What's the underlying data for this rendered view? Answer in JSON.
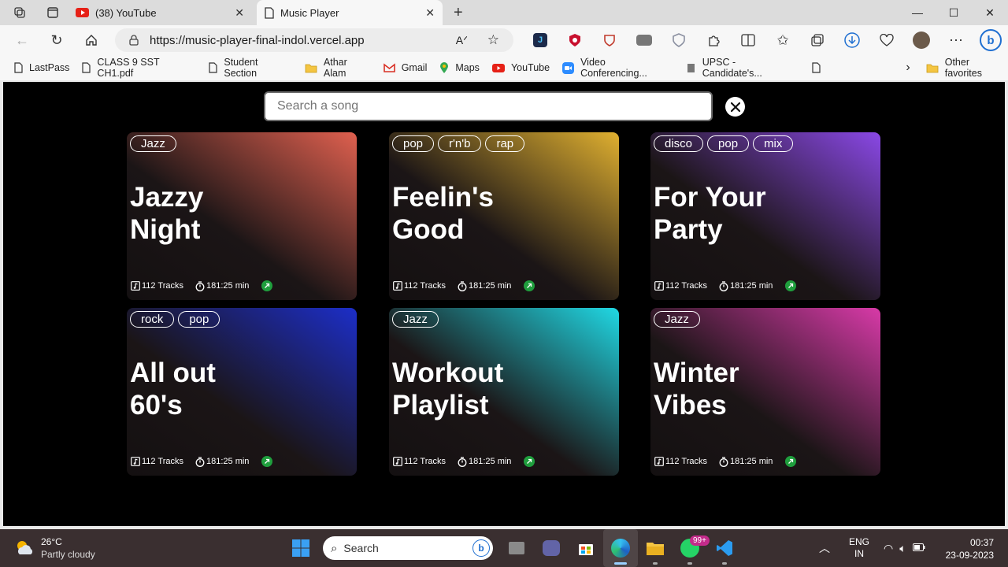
{
  "browser": {
    "tabs": [
      {
        "title": "(38) YouTube",
        "active": false
      },
      {
        "title": "Music Player",
        "active": true
      }
    ],
    "url": "https://music-player-final-indol.vercel.app",
    "bookmarks": [
      "LastPass",
      "CLASS 9 SST CH1.pdf",
      "Student Section",
      "Athar Alam",
      "Gmail",
      "Maps",
      "YouTube",
      "Video Conferencing...",
      "UPSC - Candidate's..."
    ],
    "other_favorites": "Other favorites"
  },
  "app": {
    "search_placeholder": "Search a song",
    "playlists": [
      {
        "title_line1": "Jazzy",
        "title_line2": "Night",
        "tags": [
          "Jazz"
        ],
        "tracks": "112 Tracks",
        "duration": "181:25 min",
        "color": "#e0604f"
      },
      {
        "title_line1": "Feelin's",
        "title_line2": "Good",
        "tags": [
          "pop",
          "r'n'b",
          "rap"
        ],
        "tracks": "112 Tracks",
        "duration": "181:25 min",
        "color": "#e0b030"
      },
      {
        "title_line1": "For Your",
        "title_line2": "Party",
        "tags": [
          "disco",
          "pop",
          "mix"
        ],
        "tracks": "112 Tracks",
        "duration": "181:25 min",
        "color": "#8a48e6"
      },
      {
        "title_line1": "All out",
        "title_line2": "60's",
        "tags": [
          "rock",
          "pop"
        ],
        "tracks": "112 Tracks",
        "duration": "181:25 min",
        "color": "#1c2ec8"
      },
      {
        "title_line1": "Workout",
        "title_line2": "Playlist",
        "tags": [
          "Jazz"
        ],
        "tracks": "112 Tracks",
        "duration": "181:25 min",
        "color": "#20d8e4"
      },
      {
        "title_line1": "Winter",
        "title_line2": "Vibes",
        "tags": [
          "Jazz"
        ],
        "tracks": "112 Tracks",
        "duration": "181:25 min",
        "color": "#d83aa8"
      }
    ]
  },
  "taskbar": {
    "temperature": "26°C",
    "weather": "Partly cloudy",
    "search_label": "Search",
    "whatsapp_badge": "99+",
    "lang": "ENG",
    "region": "IN",
    "time": "00:37",
    "date": "23-09-2023"
  }
}
